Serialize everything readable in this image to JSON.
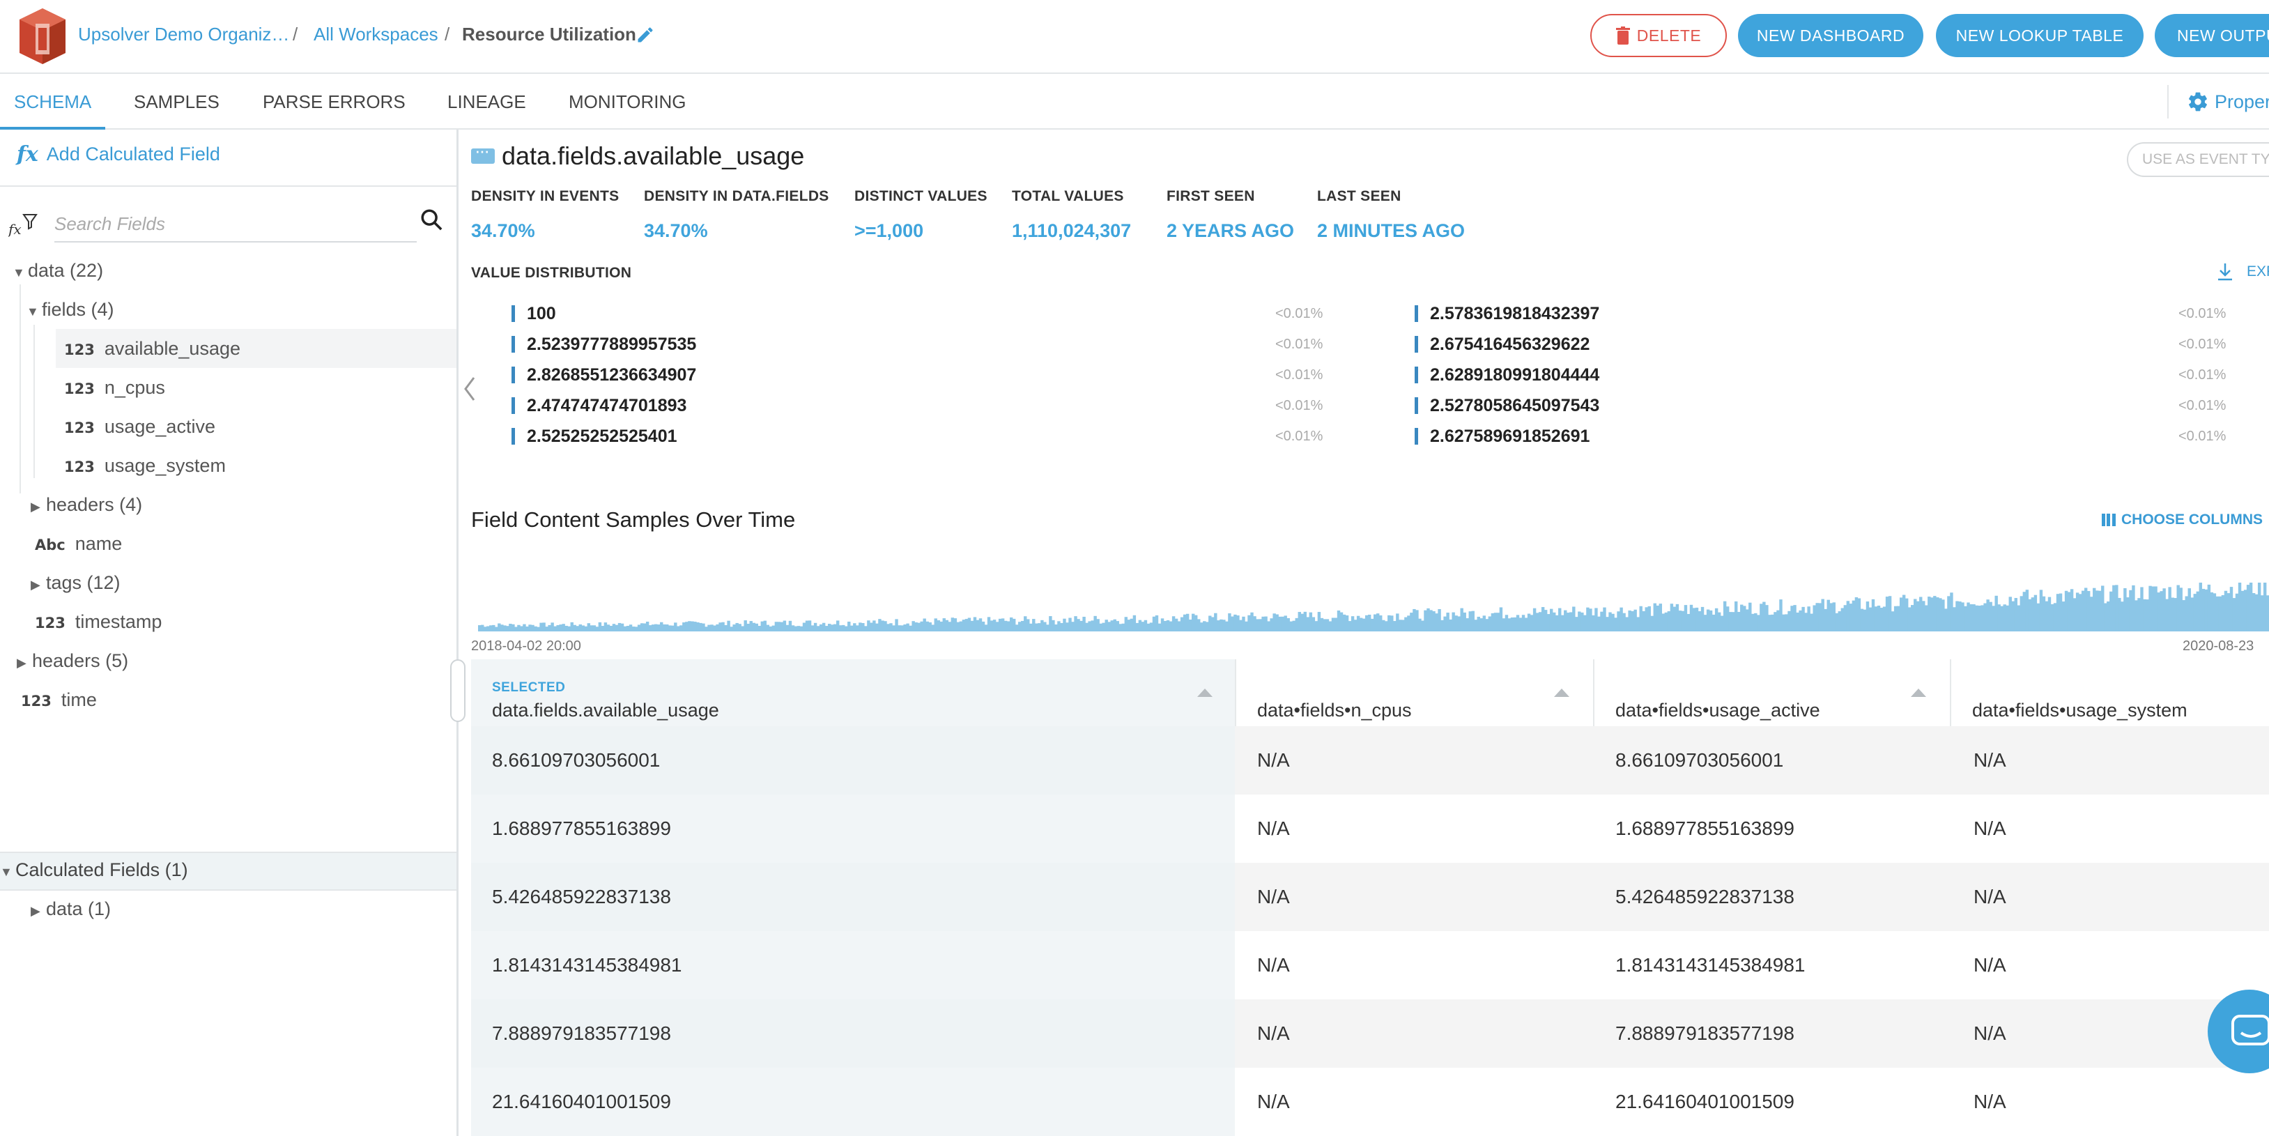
{
  "header": {
    "org": "Upsolver Demo Organiz…",
    "sep1": "/",
    "workspaces": "All Workspaces",
    "sep2": "/",
    "current": "Resource Utilization",
    "buttons": {
      "delete": "DELETE",
      "new_dashboard": "NEW DASHBOARD",
      "new_lookup": "NEW LOOKUP TABLE",
      "new_output": "NEW OUTPUT"
    },
    "delete_color": "#e0534a",
    "accent": "#3fa4dc"
  },
  "tabs": {
    "items": [
      "SCHEMA",
      "SAMPLES",
      "PARSE ERRORS",
      "LINEAGE",
      "MONITORING"
    ],
    "active": "SCHEMA",
    "properties": "Properties"
  },
  "sidebar": {
    "add_calc": "Add Calculated Field",
    "search_placeholder": "Search Fields",
    "tree": {
      "data": "data (22)",
      "fields": "fields (4)",
      "available_usage": "available_usage",
      "n_cpus": "n_cpus",
      "usage_active": "usage_active",
      "usage_system": "usage_system",
      "headers_inner": "headers (4)",
      "name": "name",
      "tags": "tags (12)",
      "timestamp": "timestamp",
      "headers_outer": "headers (5)",
      "time": "time",
      "calculated": "Calculated Fields (1)",
      "calc_data": "data (1)",
      "type_num": "123",
      "type_str": "Abc"
    }
  },
  "field": {
    "title": "data.fields.available_usage",
    "event_type_btn": "USE AS EVENT TYPE",
    "stats": [
      {
        "label": "DENSITY IN EVENTS",
        "value": "34.70%"
      },
      {
        "label": "DENSITY IN DATA.FIELDS",
        "value": "34.70%"
      },
      {
        "label": "DISTINCT VALUES",
        "value": ">=1,000"
      },
      {
        "label": "TOTAL VALUES",
        "value": "1,110,024,307"
      },
      {
        "label": "FIRST SEEN",
        "value": "2 YEARS AGO"
      },
      {
        "label": "LAST SEEN",
        "value": "2 MINUTES AGO"
      }
    ],
    "value_distribution_label": "VALUE DISTRIBUTION",
    "export": "EXPORT",
    "distribution_left": [
      {
        "value": "100",
        "pct": "<0.01%"
      },
      {
        "value": "2.5239777889957535",
        "pct": "<0.01%"
      },
      {
        "value": "2.8268551236634907",
        "pct": "<0.01%"
      },
      {
        "value": "2.474747474701893",
        "pct": "<0.01%"
      },
      {
        "value": "2.52525252525401",
        "pct": "<0.01%"
      }
    ],
    "distribution_right": [
      {
        "value": "2.5783619818432397",
        "pct": "<0.01%"
      },
      {
        "value": "2.675416456329622",
        "pct": "<0.01%"
      },
      {
        "value": "2.6289180991804444",
        "pct": "<0.01%"
      },
      {
        "value": "2.5278058645097543",
        "pct": "<0.01%"
      },
      {
        "value": "2.627589691852691",
        "pct": "<0.01%"
      }
    ]
  },
  "samples": {
    "title": "Field Content Samples Over Time",
    "choose_columns": "CHOOSE COLUMNS",
    "axis_start": "2018-04-02 20:00",
    "axis_end": "2020-08-23",
    "histogram_color": "#8cc6e7",
    "table": {
      "selected_label": "SELECTED",
      "columns": [
        "data.fields.available_usage",
        "data•fields•n_cpus",
        "data•fields•usage_active",
        "data•fields•usage_system"
      ],
      "rows": [
        [
          "8.66109703056001",
          "N/A",
          "8.66109703056001",
          "N/A"
        ],
        [
          "1.688977855163899",
          "N/A",
          "1.688977855163899",
          "N/A"
        ],
        [
          "5.426485922837138",
          "N/A",
          "5.426485922837138",
          "N/A"
        ],
        [
          "1.8143143145384981",
          "N/A",
          "1.8143143145384981",
          "N/A"
        ],
        [
          "7.888979183577198",
          "N/A",
          "7.888979183577198",
          "N/A"
        ],
        [
          "21.64160401001509",
          "N/A",
          "21.64160401001509",
          "N/A"
        ]
      ]
    }
  }
}
